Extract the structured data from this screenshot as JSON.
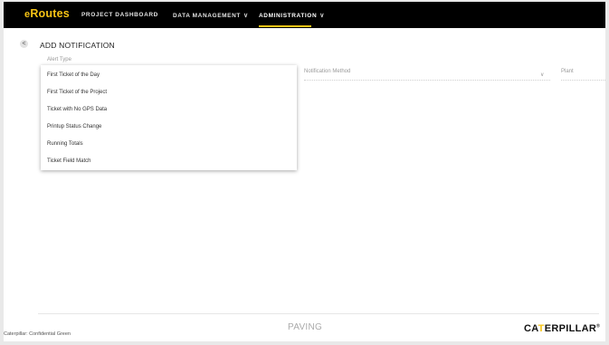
{
  "app": {
    "logo_prefix": "e",
    "logo_main": "Routes"
  },
  "nav": {
    "items": [
      {
        "label": "PROJECT DASHBOARD",
        "has_chevron": false,
        "active": false
      },
      {
        "label": "DATA MANAGEMENT",
        "has_chevron": true,
        "active": false
      },
      {
        "label": "ADMINISTRATION",
        "has_chevron": true,
        "active": true
      }
    ],
    "chevron": "∨"
  },
  "page": {
    "back_glyph": "<",
    "title": "ADD NOTIFICATION"
  },
  "form": {
    "alert_type_label": "Alert Type",
    "notification_method_label": "Notification Method",
    "plant_label": "Plant",
    "chevron": "∨"
  },
  "dropdown": {
    "options": [
      "First Ticket of the Day",
      "First Ticket of the Project",
      "Ticket with No GPS Data",
      "Printup Status Change",
      "Running Totals",
      "Ticket Field Match"
    ]
  },
  "footer": {
    "confidential": "Caterpillar: Confidential Green",
    "product": "PAVING",
    "brand_pre": "CA",
    "brand_tri": "T",
    "brand_post": "ERPILLAR",
    "trademark": "®"
  },
  "colors": {
    "accent": "#f6c315",
    "topbar": "#000000"
  }
}
